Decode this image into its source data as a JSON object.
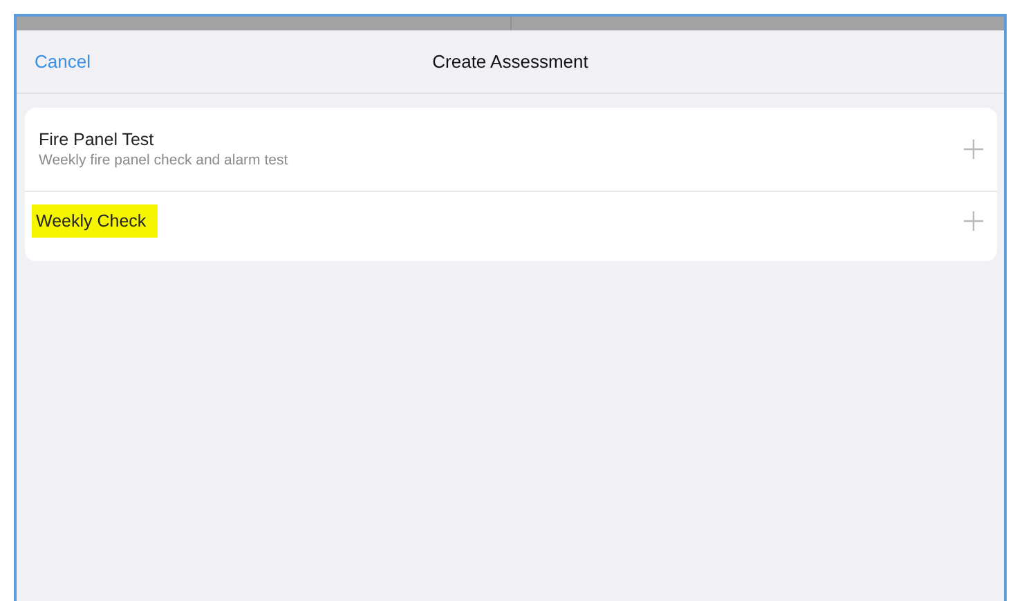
{
  "header": {
    "cancel": "Cancel",
    "title": "Create Assessment"
  },
  "items": [
    {
      "title": "Fire Panel Test",
      "subtitle": "Weekly fire panel check and alarm test",
      "highlighted": false
    },
    {
      "title": "Weekly Check",
      "highlighted": true
    }
  ]
}
